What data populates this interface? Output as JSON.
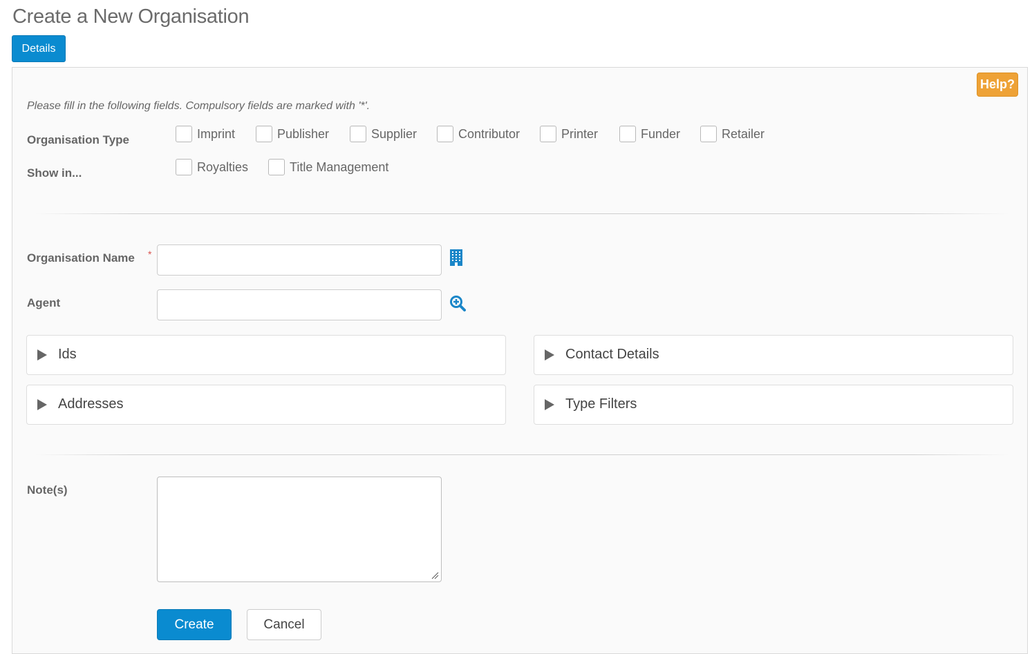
{
  "page": {
    "title": "Create a New Organisation"
  },
  "tabs": [
    {
      "label": "Details",
      "active": true
    }
  ],
  "help": {
    "label": "Help?"
  },
  "form": {
    "instructions": "Please fill in the following fields. Compulsory fields are marked with '*'.",
    "organisation_type": {
      "label": "Organisation Type",
      "options": [
        {
          "label": "Imprint",
          "checked": false
        },
        {
          "label": "Publisher",
          "checked": false
        },
        {
          "label": "Supplier",
          "checked": false
        },
        {
          "label": "Contributor",
          "checked": false
        },
        {
          "label": "Printer",
          "checked": false
        },
        {
          "label": "Funder",
          "checked": false
        },
        {
          "label": "Retailer",
          "checked": false
        }
      ]
    },
    "show_in": {
      "label": "Show in...",
      "options": [
        {
          "label": "Royalties",
          "checked": false
        },
        {
          "label": "Title Management",
          "checked": false
        }
      ]
    },
    "organisation_name": {
      "label": "Organisation Name",
      "required_marker": "*",
      "value": "",
      "icon": "building-icon"
    },
    "agent": {
      "label": "Agent",
      "value": "",
      "icon": "zoom-in-icon"
    },
    "sections": [
      {
        "label": "Ids",
        "expanded": false
      },
      {
        "label": "Contact Details",
        "expanded": false
      },
      {
        "label": "Addresses",
        "expanded": false
      },
      {
        "label": "Type Filters",
        "expanded": false
      }
    ],
    "notes": {
      "label": "Note(s)",
      "value": ""
    },
    "buttons": {
      "create": "Create",
      "cancel": "Cancel"
    }
  },
  "colors": {
    "primary": "#0a8bd0",
    "help": "#eea236",
    "required": "#d9534f"
  }
}
